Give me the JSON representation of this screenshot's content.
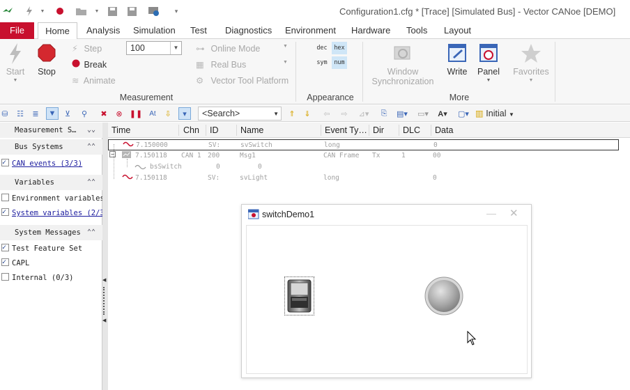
{
  "window": {
    "title": "Configuration1.cfg * [Trace] [Simulated Bus] - Vector CANoe [DEMO]"
  },
  "quick_access": [
    "app-icon",
    "lightning-icon",
    "record-icon",
    "open-folder-icon",
    "save-icon",
    "save-as-icon",
    "config-icon",
    "customize-icon"
  ],
  "tabs": [
    "File",
    "Home",
    "Analysis",
    "Simulation",
    "Test",
    "Diagnostics",
    "Environment",
    "Hardware",
    "Tools",
    "Layout"
  ],
  "ribbon": {
    "start": "Start",
    "stop": "Stop",
    "step": "Step",
    "break": "Break",
    "animate": "Animate",
    "speed_value": "100",
    "online_mode": "Online Mode",
    "real_bus": "Real Bus",
    "vector_tool_platform": "Vector Tool Platform",
    "dec": "dec",
    "hex": "hex",
    "sym": "sym",
    "num": "num",
    "window_sync_1": "Window",
    "window_sync_2": "Synchronization",
    "write": "Write",
    "panel": "Panel",
    "favorites": "Favorites",
    "group_measurement": "Measurement",
    "group_appearance": "Appearance",
    "group_more": "More"
  },
  "toolbar": {
    "search_placeholder": "<Search>",
    "initial": "Initial"
  },
  "left_panel": {
    "sections": [
      {
        "title": "Measurement S…"
      },
      {
        "title": "Bus Systems"
      },
      {
        "title": "Variables"
      },
      {
        "title": "System Messages"
      }
    ],
    "items": [
      {
        "label": "CAN events (3/3)",
        "checked": true
      },
      {
        "label": "Environment variables",
        "checked": false
      },
      {
        "label": "System variables (2/3)",
        "checked": true
      },
      {
        "label": "Test Feature Set",
        "checked": true
      },
      {
        "label": "CAPL",
        "checked": true
      },
      {
        "label": "Internal (0/3)",
        "checked": false
      }
    ]
  },
  "trace": {
    "columns": [
      "Time",
      "Chn",
      "ID",
      "Name",
      "Event Ty…",
      "Dir",
      "DLC",
      "Data"
    ],
    "rows": [
      {
        "time": "7.150000",
        "chn": "SV:",
        "id": "",
        "name": "svSwitch",
        "type": "long",
        "dir": "",
        "dlc": "",
        "data": "0"
      },
      {
        "time": "7.150118",
        "chn": "CAN 1",
        "id": "200",
        "name": "Msg1",
        "type": "CAN Frame",
        "dir": "Tx",
        "dlc": "1",
        "data": "00"
      },
      {
        "time": "",
        "chn": "",
        "id": "0",
        "name": "bsSwitch",
        "type": "",
        "dir": "",
        "dlc": "",
        "data": "0"
      },
      {
        "time": "7.150118",
        "chn": "SV:",
        "id": "",
        "name": "svLight",
        "type": "long",
        "dir": "",
        "dlc": "",
        "data": "0"
      }
    ]
  },
  "dialog": {
    "title": "switchDemo1"
  }
}
